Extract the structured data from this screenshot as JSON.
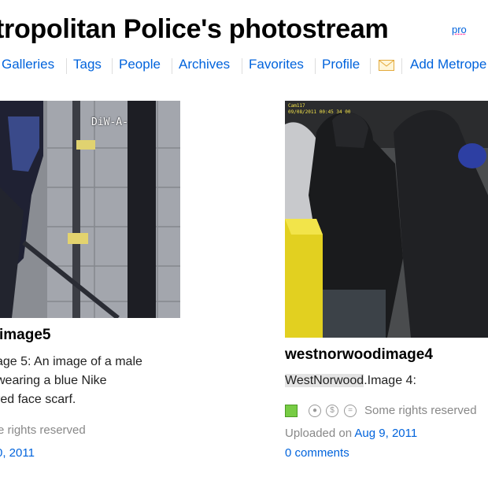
{
  "header": {
    "title": "tropolitan Police's photostream",
    "badge": "pro"
  },
  "nav": {
    "items": [
      "Galleries",
      "Tags",
      "People",
      "Archives",
      "Favorites",
      "Profile"
    ],
    "mail_icon": "envelope-icon",
    "add_link": "Add Metrope"
  },
  "photos": [
    {
      "overlay_text": "DiW-A-",
      "title": "image5",
      "description_lines": [
        "age 5: An image of a male",
        "wearing a blue Nike",
        "red face scarf."
      ],
      "rights": "e rights reserved",
      "date": "0, 2011"
    },
    {
      "camera_stamp": "Cam117",
      "camera_time": "09/08/2011 00:45 34 00",
      "title": "westnorwoodimage4",
      "description_highlight": "WestNorwood",
      "description_rest": ".Image 4:",
      "rights": "Some rights reserved",
      "license_icons": [
        "license-square-icon",
        "attribution-icon",
        "noncommercial-icon",
        "noderivs-icon"
      ],
      "uploaded_label": "Uploaded on",
      "uploaded_date": "Aug 9, 2011",
      "comments": "0 comments"
    }
  ],
  "colors": {
    "link": "#0063dc",
    "pro_underline": "#ff0084",
    "license_green": "#77cc44"
  }
}
